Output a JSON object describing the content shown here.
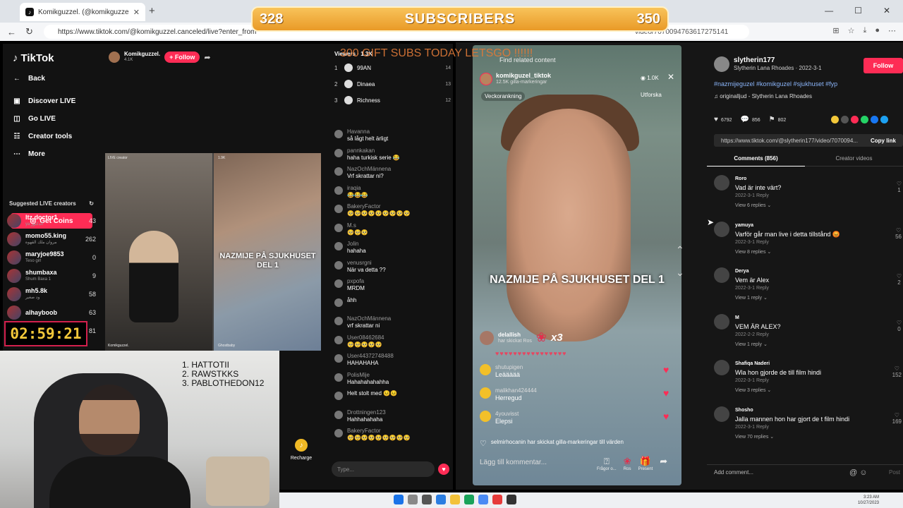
{
  "browser": {
    "tab_title": "Komikguzzel. (@komikguzzel.canceled)",
    "url": "https://www.tiktok.com/@komikguzzel.canceled/live?enter_from",
    "url_right": "video/7070094763617275141"
  },
  "overlay": {
    "sub_count": "328",
    "sub_title": "SUBSCRIBERS",
    "sub_goal": "350",
    "gift_text": "300 GIFT SUBS TODAY LETSGO !!!!!!",
    "timer": "02:59:21",
    "top_list": [
      "1.  HATTOTII",
      "2.  RAWSTKKS",
      "3.  PABLOTHEDON12"
    ]
  },
  "left": {
    "logo": "TikTok",
    "back": "Back",
    "nav": [
      "Discover LIVE",
      "Go LIVE",
      "Creator tools",
      "More"
    ],
    "get_coins": "Get Coins",
    "suggested_title": "Suggested LIVE creators",
    "creators": [
      {
        "name": "ltz.doctor1",
        "sub": "ya الدكتور",
        "count": "43"
      },
      {
        "name": "momo55.king",
        "sub": "مروان ملك القهوة",
        "count": "262"
      },
      {
        "name": "maryjoe9853",
        "sub": "Teso girl",
        "count": "0"
      },
      {
        "name": "shumbaxa",
        "sub": "Shum Baxa 1",
        "count": "9"
      },
      {
        "name": "mh5.8k",
        "sub": "ود صغير",
        "count": "58"
      },
      {
        "name": "alhayboob",
        "sub": "",
        "count": "63"
      },
      {
        "name": "",
        "sub": "",
        "count": "81"
      }
    ],
    "host_name": "Komikguzzel.",
    "host_likes": "4.1K",
    "follow": "+ Follow",
    "video_title": "NAZMIJE PÅ SJUKHUSET DEL 1",
    "live_tag": "LIVE creator",
    "views_tag": "1.9K",
    "cam_name": "Komikguzzel.",
    "cam_name2": "Ghostbaby",
    "viewers_head": "Viewers · 1.3K",
    "viewers": [
      {
        "rank": "1",
        "name": "99AN",
        "score": "14"
      },
      {
        "rank": "2",
        "name": "Dinaea",
        "score": "13"
      },
      {
        "rank": "3",
        "name": "Richness",
        "score": "12"
      }
    ],
    "chat": [
      {
        "user": "Havanna",
        "text": "så lågt helt ärligt"
      },
      {
        "user": "pannkakan",
        "text": "haha turkisk serie 😂"
      },
      {
        "user": "NazOchMännena",
        "text": "Vrf skrattar ni?"
      },
      {
        "user": "iraqia",
        "text": "😂😂😂"
      },
      {
        "user": "BakeryFactor",
        "text": "🥺🥺🥺🥺🥺🥺🥺🥺🥺"
      },
      {
        "user": "M.s",
        "text": "🥺🥺🥺"
      },
      {
        "user": "Jolin",
        "text": "hahaha"
      },
      {
        "user": "venusrgni",
        "text": "När va detta ??"
      },
      {
        "user": "pxpofa",
        "text": "MRDM"
      },
      {
        "user": "",
        "text": "åhh"
      },
      {
        "user": "NazOchMännena",
        "text": "vrf skrattar ni"
      },
      {
        "user": "User08462684",
        "text": "🥺🥺🥺🥺🥺"
      },
      {
        "user": "User44372748488",
        "text": "HAHAHAHA"
      },
      {
        "user": "PolisMije",
        "text": "Hahahahahahha"
      },
      {
        "user": "",
        "text": "Helt stolt med 😣😣"
      },
      {
        "user": "Drottningen123",
        "text": "Hahhahahaha"
      },
      {
        "user": "BakeryFactor",
        "text": "🥺🥺🥺🥺🥺🥺🥺🥺🥺"
      }
    ],
    "type_placeholder": "Type...",
    "recharge": "Recharge"
  },
  "phone": {
    "find": "Find related content",
    "host": "komikguzel_tiktok",
    "host_sub": "12.5K gilla-markeringar",
    "views": "1.0K",
    "week": "Veckorankning",
    "explore": "Utforska",
    "title": "NAZMIJE PÅ SJUKHUSET DEL 1",
    "gift_user": "delallish",
    "gift_sub": "har skickat Ros",
    "gift_mult": "x3",
    "hearts": "♥♥♥♥♥♥♥♥♥♥♥♥♥♥♥♥",
    "messages": [
      {
        "user": "shutupigen",
        "text": "Leäääää"
      },
      {
        "user": "malikhan424444",
        "text": "Herregud"
      },
      {
        "user": "4youvisst",
        "text": "Elepsi"
      }
    ],
    "system_msg": "selmirhocanin har skickat gilla-markeringar till värden",
    "comment_placeholder": "Lägg till kommentar...",
    "buttons": [
      "Frågor o...",
      "Ros",
      "Present",
      ""
    ]
  },
  "detail": {
    "user": "slytherin177",
    "user_sub": "Slytherin Lana Rhoades · 2022-3-1",
    "follow": "Follow",
    "tags": "#nazmijeguzel #komikguzel #sjukhuset #fyp",
    "sound": "♫ originalljud - Slytherin Lana Rhoades",
    "likes": "6792",
    "comments": "856",
    "saves": "802",
    "link": "https://www.tiktok.com/@slytherin177/video/7070094...",
    "copy": "Copy link",
    "tab_comments": "Comments (856)",
    "tab_creator": "Creator videos",
    "comment_list": [
      {
        "user": "Roro",
        "text": "Vad är inte värt?",
        "meta": "2022-3-1   Reply",
        "replies": "View 6 replies ⌄",
        "likes": "1"
      },
      {
        "user": "yamuya",
        "text": "Varför går man live i detta tillstånd 😡",
        "meta": "2022-3-1   Reply",
        "replies": "View 8 replies ⌄",
        "likes": "56"
      },
      {
        "user": "Derya",
        "text": "Vem är Alex",
        "meta": "2022-3-1   Reply",
        "replies": "View 1 reply ⌄",
        "likes": "2"
      },
      {
        "user": "M",
        "text": "VEM ÄR ALEX?",
        "meta": "2022-2-2   Reply",
        "replies": "View 1 reply ⌄",
        "likes": "0"
      },
      {
        "user": "Shafiqa Naderi",
        "text": "Wla hon gjorde de till film hindi",
        "meta": "2022-3-1   Reply",
        "replies": "View 3 replies ⌄",
        "likes": "152"
      },
      {
        "user": "Shosho",
        "text": "Jalla mannen hon har gjort de t film hindi",
        "meta": "2022-3-1   Reply",
        "replies": "View 70 replies ⌄",
        "likes": "169"
      }
    ],
    "add_comment": "Add comment...",
    "post": "Post"
  },
  "taskbar": {
    "time": "3:23 AM",
    "date": "10/27/2023"
  },
  "colors": {
    "tiktok_red": "#fe2c55",
    "gold": "#f3c83a",
    "overlay_orange": "#e99a27"
  }
}
